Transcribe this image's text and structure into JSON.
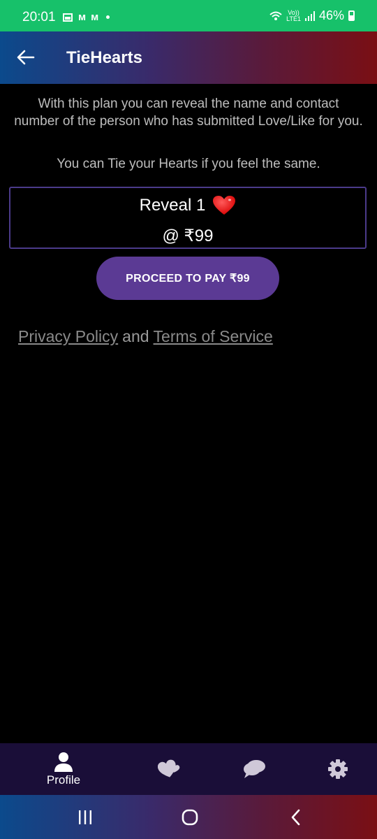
{
  "status_bar": {
    "time": "20:01",
    "lte_top": "Vo))",
    "lte_bottom": "LTE1",
    "battery": "46%",
    "icons": [
      "gallery-icon",
      "gmail-icon",
      "gmail-icon",
      "dot-icon",
      "wifi-icon",
      "lte-icon",
      "signal-icon",
      "battery-icon"
    ]
  },
  "app_bar": {
    "title": "TieHearts",
    "back_icon": "arrow-left-icon"
  },
  "content": {
    "description": "With this plan you can reveal the name and contact number of the person who has submitted Love/Like for you.",
    "tagline": "You can Tie your Hearts if you feel the same.",
    "plan": {
      "title": "Reveal 1",
      "price": "@ ₹99",
      "icon": "heart-icon"
    },
    "pay_button": "PROCEED TO PAY ₹99",
    "privacy_link": "Privacy Policy",
    "and_text": "and",
    "terms_link": "Terms of Service"
  },
  "bottom_nav": {
    "items": [
      {
        "label": "Profile",
        "icon": "person-icon"
      },
      {
        "label": "",
        "icon": "hearts-icon"
      },
      {
        "label": "",
        "icon": "chat-icon"
      },
      {
        "label": "",
        "icon": "gear-icon"
      }
    ]
  },
  "colors": {
    "status_bar": "#17c16a",
    "accent": "#5b3a94",
    "card_border": "#4b3a8a",
    "nav_bg": "#1a0e38",
    "heart": "#e01010"
  }
}
